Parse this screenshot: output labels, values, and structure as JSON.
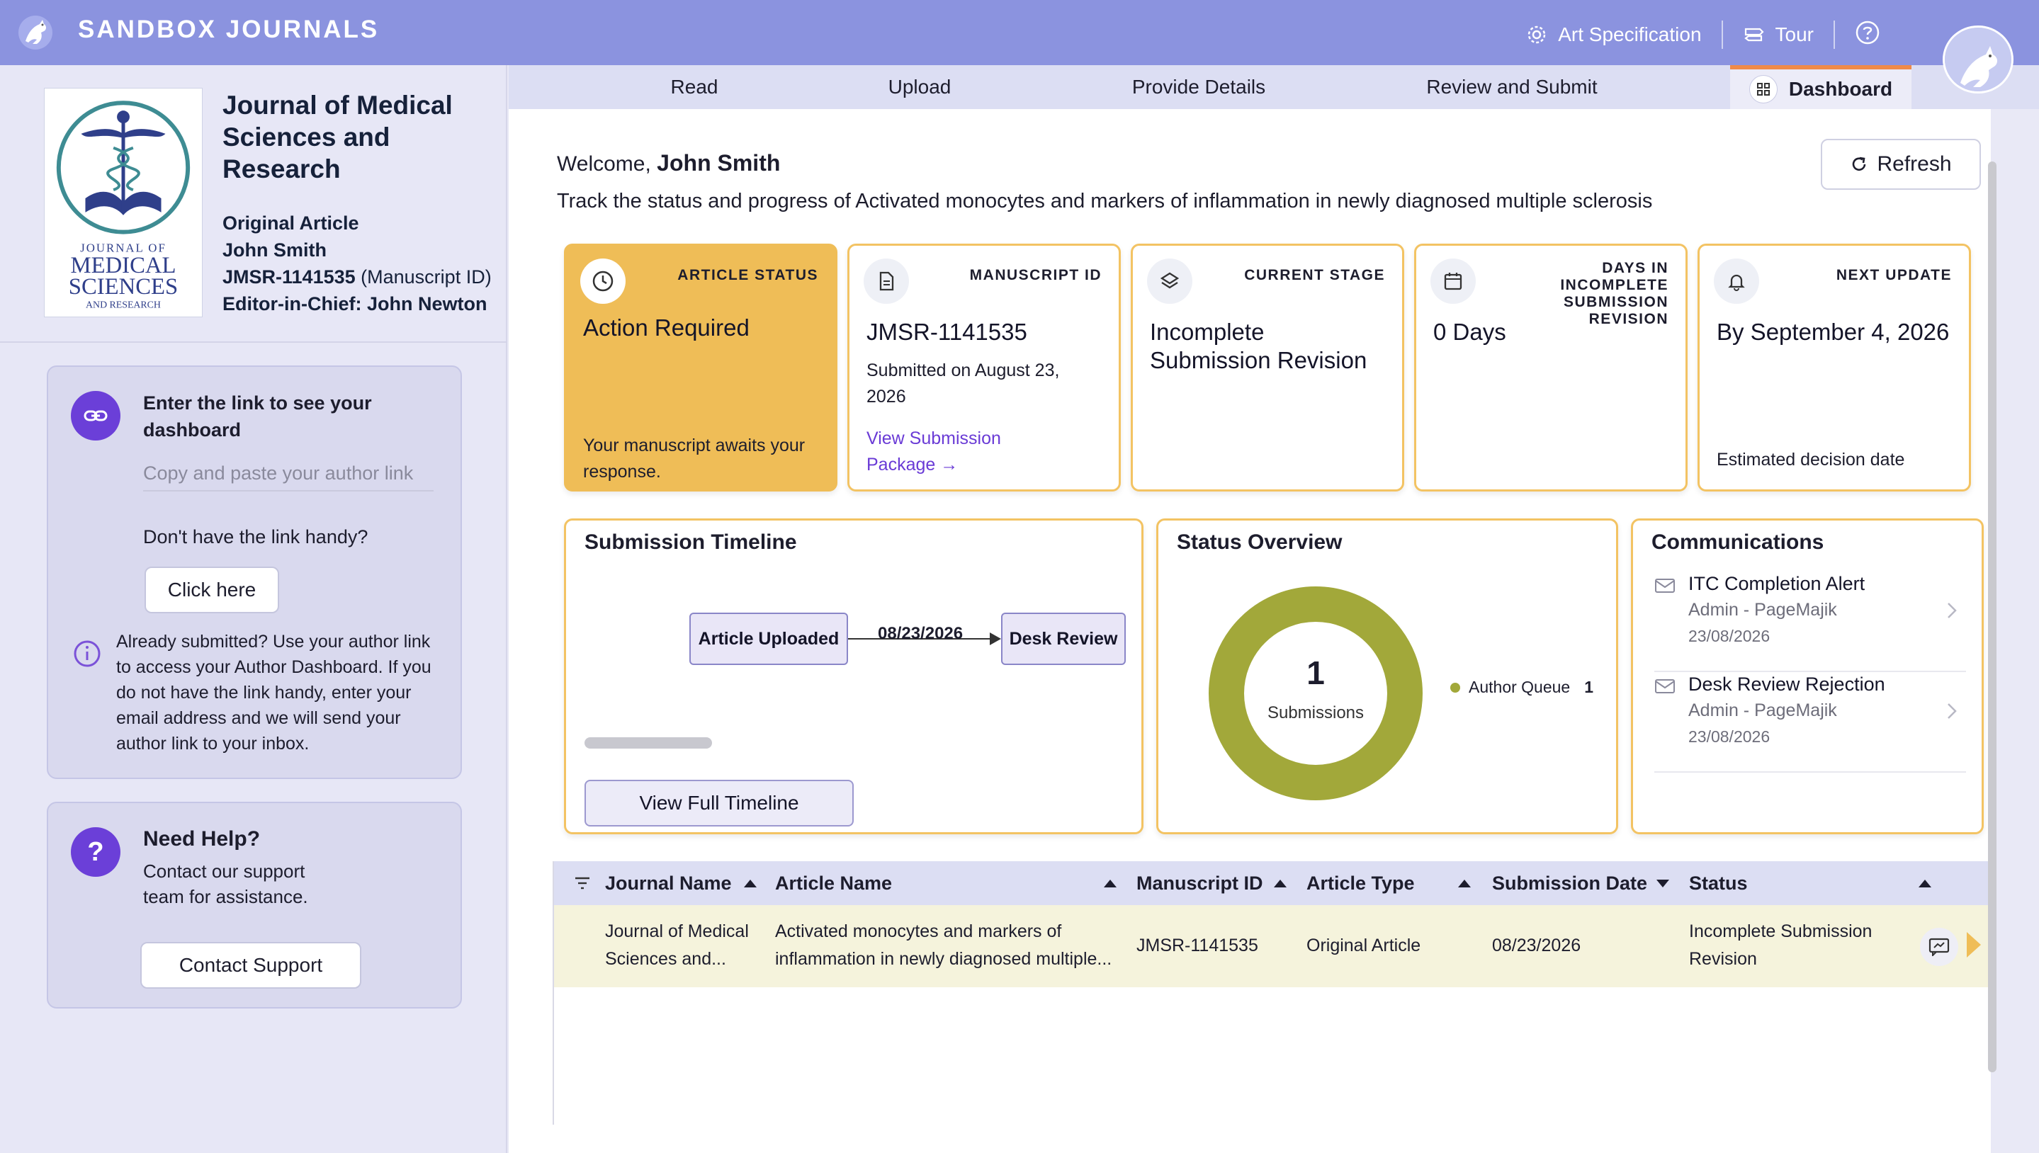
{
  "app": {
    "brand": "SANDBOX JOURNALS",
    "art_spec_label": "Art Specification",
    "tour_label": "Tour"
  },
  "sidebar": {
    "journal_title": "Journal of Medical Sciences and Research",
    "cover_lines": [
      "JOURNAL OF",
      "MEDICAL",
      "SCIENCES",
      "AND RESEARCH"
    ],
    "article_type": "Original Article",
    "author": "John Smith",
    "manuscript_id": "JMSR-1141535",
    "manuscript_id_suffix": "(Manuscript ID)",
    "editor": "Editor-in-Chief: John Newton",
    "link_card": {
      "title": "Enter the link to see your dashboard",
      "placeholder": "Copy and paste your author link",
      "no_link_text": "Don't have the link handy?",
      "click_here_label": "Click here",
      "info_text": "Already submitted? Use your author link to access your Author Dashboard. If you do not have the link handy, enter your email address and we will send your author link to your inbox."
    },
    "help_card": {
      "title": "Need Help?",
      "text": "Contact our support team for assistance.",
      "button_label": "Contact Support"
    }
  },
  "tabs": [
    "Read",
    "Upload",
    "Provide Details",
    "Review and Submit",
    "Dashboard"
  ],
  "main": {
    "welcome_prefix": "Welcome,",
    "user_name": "John Smith",
    "track_text": "Track the status and progress of Activated monocytes and markers of inflammation in newly diagnosed multiple sclerosis",
    "refresh_label": "Refresh",
    "stats": [
      {
        "label": "ARTICLE STATUS",
        "value": "Action Required",
        "sub": "Your manuscript awaits your response.",
        "icon": "clock-icon"
      },
      {
        "label": "MANUSCRIPT ID",
        "value": "JMSR-1141535",
        "sub": "Submitted on August 23, 2026",
        "link": "View Submission Package →",
        "icon": "document-icon"
      },
      {
        "label": "CURRENT STAGE",
        "value": "Incomplete Submission Revision",
        "icon": "layers-icon"
      },
      {
        "label": "DAYS IN INCOMPLETE SUBMISSION REVISION",
        "value": "0 Days",
        "icon": "calendar-icon"
      },
      {
        "label": "NEXT UPDATE",
        "value": "By September 4, 2026",
        "sub": "Estimated decision date",
        "icon": "bell-icon"
      }
    ],
    "timeline": {
      "title": "Submission Timeline",
      "nodes": [
        "Article Uploaded",
        "Desk Review"
      ],
      "edge_label": "08/23/2026",
      "button_label": "View Full Timeline"
    },
    "status_overview": {
      "title": "Status Overview",
      "total": "1",
      "total_caption": "Submissions",
      "legend": [
        {
          "name": "Author Queue",
          "count": "1",
          "color": "#a2a83a"
        }
      ]
    },
    "communications": {
      "title": "Communications",
      "items": [
        {
          "title": "ITC Completion Alert",
          "from": "Admin - PageMajik",
          "date": "23/08/2026"
        },
        {
          "title": "Desk Review Rejection",
          "from": "Admin - PageMajik",
          "date": "23/08/2026"
        }
      ]
    },
    "table": {
      "columns": [
        "Journal Name",
        "Article Name",
        "Manuscript ID",
        "Article Type",
        "Submission Date",
        "Status"
      ],
      "rows": [
        {
          "journal": "Journal of Medical Sciences and...",
          "article": "Activated monocytes and markers of inflammation in newly diagnosed multiple...",
          "manuscript_id": "JMSR-1141535",
          "type": "Original Article",
          "date": "08/23/2026",
          "status": "Incomplete Submission Revision"
        }
      ]
    }
  },
  "colors": {
    "header": "#8b93df",
    "accent_purple": "#6b3fd8",
    "status_highlight": "#efbd57",
    "card_border": "#f3c363",
    "donut": "#a2a83a"
  }
}
